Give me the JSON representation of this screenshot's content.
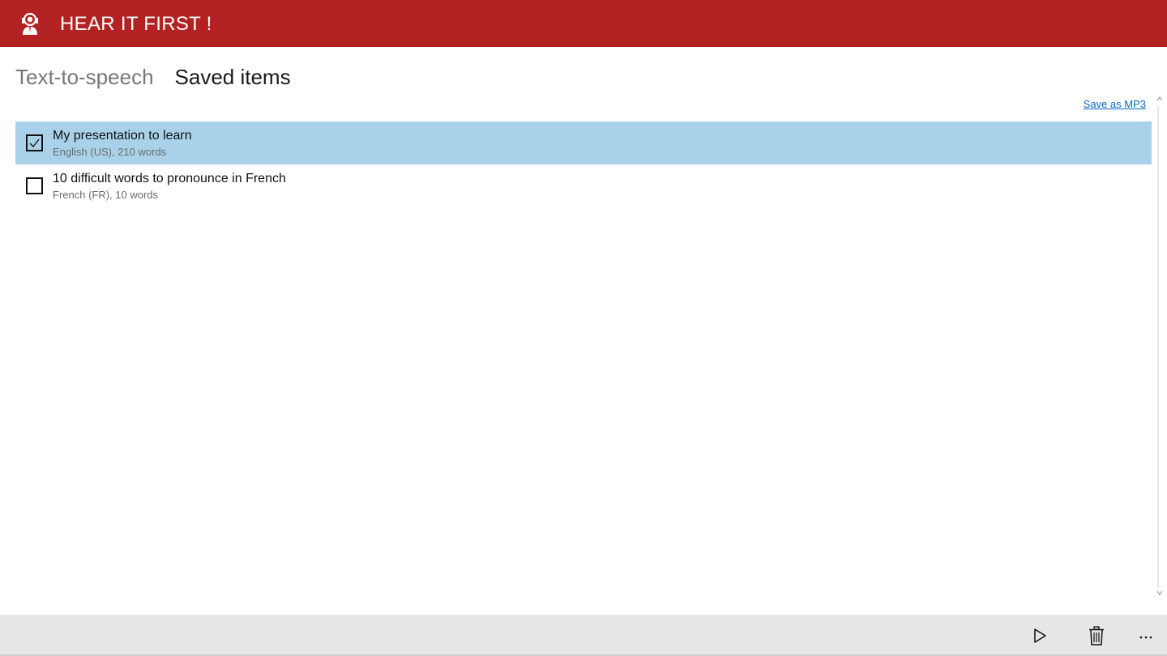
{
  "app": {
    "title": "HEAR IT FIRST !",
    "brand_color": "#b22222",
    "icon": "headset-user-icon"
  },
  "tabs": [
    {
      "label": "Text-to-speech",
      "active": false
    },
    {
      "label": "Saved items",
      "active": true
    }
  ],
  "actions": {
    "save_mp3": "Save as MP3"
  },
  "items": [
    {
      "title": "My presentation to learn",
      "subtitle": "English (US), 210 words",
      "checked": true,
      "selected": true
    },
    {
      "title": "10 difficult words to pronounce in French",
      "subtitle": "French (FR), 10 words",
      "checked": false,
      "selected": false
    }
  ],
  "selection_color": "#a9d2ea",
  "bottom_bar": {
    "buttons": [
      {
        "icon": "play-icon"
      },
      {
        "icon": "trash-icon"
      },
      {
        "icon": "more-icon"
      }
    ]
  }
}
